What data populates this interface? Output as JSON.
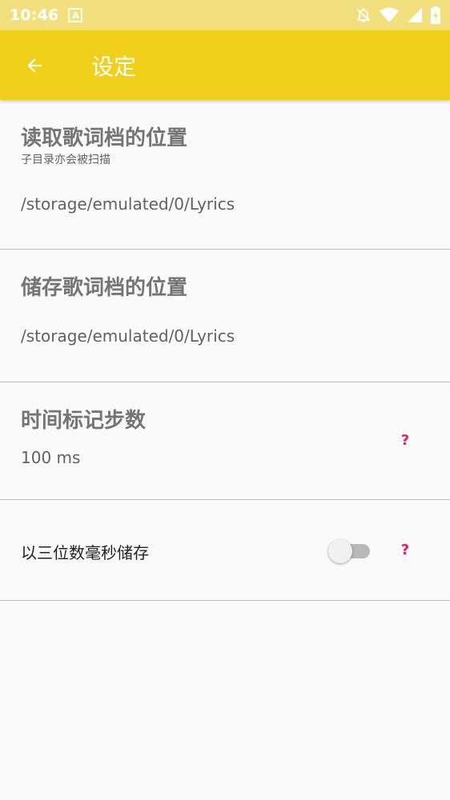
{
  "status_bar": {
    "time": "10:46",
    "notification_badge": "A",
    "icons": [
      "notifications-off-icon",
      "wifi-icon",
      "cell-signal-icon",
      "battery-charging-icon"
    ]
  },
  "app_bar": {
    "title": "设定",
    "back_icon": "arrow-back-icon",
    "color": "#f0d01a"
  },
  "settings": {
    "read_location": {
      "title": "读取歌词档的位置",
      "subtitle": "子目录亦会被扫描",
      "value": "/storage/emulated/0/Lyrics"
    },
    "save_location": {
      "title": "储存歌词档的位置",
      "value": "/storage/emulated/0/Lyrics"
    },
    "timestamp_step": {
      "title": "时间标记步数",
      "value": "100 ms",
      "help": "?"
    },
    "three_digit_ms": {
      "label": "以三位数毫秒储存",
      "enabled": false,
      "help": "?"
    }
  },
  "colors": {
    "accent": "#e91e63",
    "status_bar": "#f2e07e"
  }
}
